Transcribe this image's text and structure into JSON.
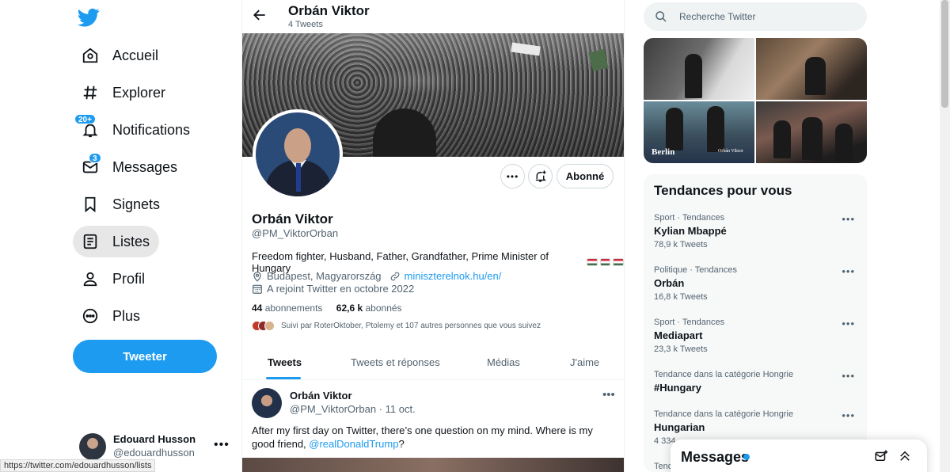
{
  "colors": {
    "accent": "#1d9bf0",
    "text": "#0f1419",
    "muted": "#536471"
  },
  "sidebar": {
    "logo_icon": "twitter-bird-icon",
    "items": [
      {
        "label": "Accueil",
        "icon": "home-icon"
      },
      {
        "label": "Explorer",
        "icon": "hashtag-icon"
      },
      {
        "label": "Notifications",
        "icon": "bell-icon",
        "badge": "20+"
      },
      {
        "label": "Messages",
        "icon": "mail-icon",
        "badge": "3"
      },
      {
        "label": "Signets",
        "icon": "bookmark-icon"
      },
      {
        "label": "Listes",
        "icon": "list-icon",
        "active": true
      },
      {
        "label": "Profil",
        "icon": "user-icon"
      },
      {
        "label": "Plus",
        "icon": "more-circle-icon"
      }
    ],
    "tweet_button": "Tweeter",
    "account": {
      "name": "Edouard Husson",
      "handle": "@edouardhusson"
    }
  },
  "status_bar_url": "https://twitter.com/edouardhusson/lists",
  "profile": {
    "header_name": "Orbán Viktor",
    "header_tweet_count": "4 Tweets",
    "name": "Orbán Viktor",
    "handle": "@PM_ViktorOrban",
    "bio": "Freedom fighter, Husband, Father, Grandfather, Prime Minister of Hungary",
    "location": "Budapest, Magyarország",
    "website": "miniszterelnok.hu/en/",
    "joined": "A rejoint Twitter en octobre 2022",
    "following_count": "44",
    "following_label": "abonnements",
    "followers_count": "62,6 k",
    "followers_label": "abonnés",
    "followed_by": "Suivi par RoterOktober, Ptolemy et 107 autres personnes que vous suivez",
    "follow_button": "Abonné"
  },
  "tabs": [
    "Tweets",
    "Tweets et réponses",
    "Médias",
    "J'aime"
  ],
  "tweet": {
    "author": "Orbán Viktor",
    "handle": "@PM_ViktorOrban",
    "date": "11 oct.",
    "text_before": "After my first day on Twitter, there’s one question on my mind. Where is my good friend, ",
    "mention": "@realDonaldTrump",
    "text_after": "?"
  },
  "search": {
    "placeholder": "Recherche Twitter"
  },
  "media_labels": {
    "berlin": "Berlin",
    "watermark": "Orbán Viktor"
  },
  "trends": {
    "title": "Tendances pour vous",
    "items": [
      {
        "category": "Sport · Tendances",
        "name": "Kylian Mbappé",
        "count": "78,9 k Tweets"
      },
      {
        "category": "Politique · Tendances",
        "name": "Orbán",
        "count": "16,8 k Tweets"
      },
      {
        "category": "Sport · Tendances",
        "name": "Mediapart",
        "count": "23,3 k Tweets"
      },
      {
        "category": "Tendance dans la catégorie Hongrie",
        "name": "#Hungary",
        "count": ""
      },
      {
        "category": "Tendance dans la catégorie Hongrie",
        "name": "Hungarian",
        "count": "4 334"
      },
      {
        "category": "Tenc",
        "name": "",
        "count": ""
      }
    ]
  },
  "messages_drawer": {
    "title": "Messages"
  }
}
